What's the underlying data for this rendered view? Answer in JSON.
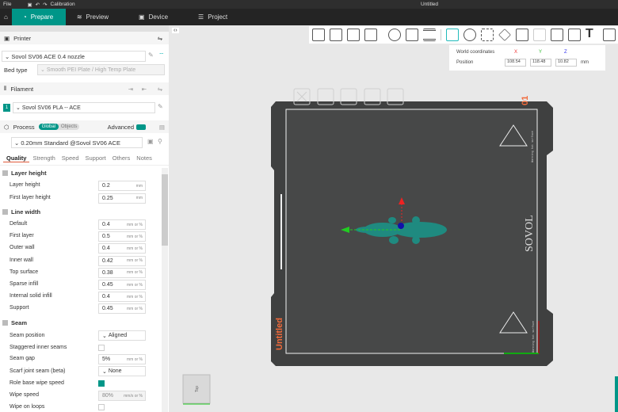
{
  "titlebar": {
    "file": "File",
    "calibration": "Calibration",
    "title": "Untitled"
  },
  "tabs": [
    "Prepare",
    "Preview",
    "Device",
    "Project"
  ],
  "printer": {
    "header": "Printer",
    "name": "Sovol SV06 ACE 0.4 nozzle",
    "bed_type_label": "Bed type",
    "bed_type": "Smooth PEI Plate / High Temp Plate"
  },
  "filament": {
    "header": "Filament",
    "index": "1",
    "name": "Sovol SV06 PLA -- ACE"
  },
  "process": {
    "header": "Process",
    "global": "Global",
    "objects": "Objects",
    "advanced": "Advanced",
    "preset": "0.20mm Standard @Sovol SV06 ACE"
  },
  "settings_tabs": [
    "Quality",
    "Strength",
    "Speed",
    "Support",
    "Others",
    "Notes"
  ],
  "groups": {
    "layer_height": {
      "title": "Layer height",
      "rows": [
        {
          "label": "Layer height",
          "value": "0.2",
          "unit": "mm"
        },
        {
          "label": "First layer height",
          "value": "0.25",
          "unit": "mm"
        }
      ]
    },
    "line_width": {
      "title": "Line width",
      "rows": [
        {
          "label": "Default",
          "value": "0.4",
          "unit": "mm or %"
        },
        {
          "label": "First layer",
          "value": "0.5",
          "unit": "mm or %"
        },
        {
          "label": "Outer wall",
          "value": "0.4",
          "unit": "mm or %"
        },
        {
          "label": "Inner wall",
          "value": "0.42",
          "unit": "mm or %"
        },
        {
          "label": "Top surface",
          "value": "0.38",
          "unit": "mm or %"
        },
        {
          "label": "Sparse infill",
          "value": "0.45",
          "unit": "mm or %"
        },
        {
          "label": "Internal solid infill",
          "value": "0.4",
          "unit": "mm or %"
        },
        {
          "label": "Support",
          "value": "0.45",
          "unit": "mm or %"
        }
      ]
    },
    "seam": {
      "title": "Seam",
      "seam_position": {
        "label": "Seam position",
        "value": "Aligned"
      },
      "staggered": {
        "label": "Staggered inner seams",
        "checked": false
      },
      "seam_gap": {
        "label": "Seam gap",
        "value": "5%",
        "unit": "mm or %"
      },
      "scarf": {
        "label": "Scarf joint seam (beta)",
        "value": "None"
      },
      "role_wipe": {
        "label": "Role base wipe speed",
        "checked": true
      },
      "wipe_speed": {
        "label": "Wipe speed",
        "value": "80%",
        "unit": "mm/s or %"
      },
      "wipe_loops": {
        "label": "Wipe on loops",
        "checked": false
      }
    }
  },
  "coords": {
    "title": "World coordinates",
    "x": "X",
    "y": "Y",
    "z": "Z",
    "position_label": "Position",
    "px": "108.54",
    "py": "118.48",
    "pz": "10.82",
    "unit": "mm"
  },
  "plate": {
    "number": "01",
    "name": "Untitled",
    "brand": "SOVOL",
    "warning": "Warning hot surface"
  },
  "viewcube": {
    "face": "Top"
  },
  "colors": {
    "accent": "#009688",
    "plate_label": "#f26a3a"
  }
}
